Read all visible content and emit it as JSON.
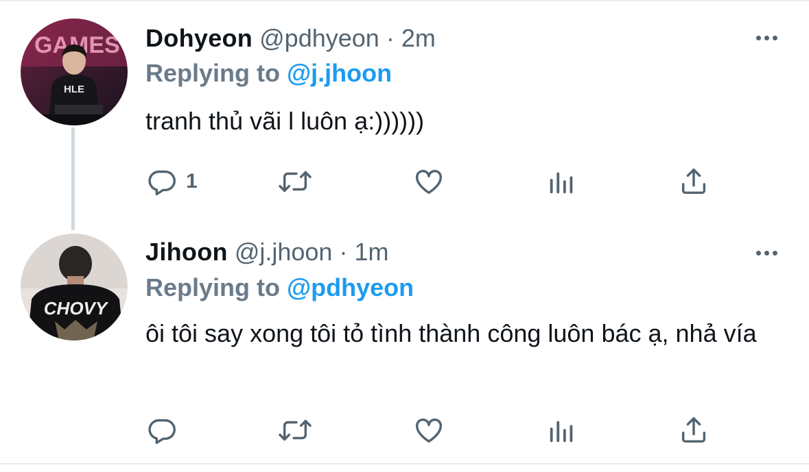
{
  "tweets": [
    {
      "display_name": "Dohyeon",
      "handle": "@pdhyeon",
      "separator": "·",
      "time": "2m",
      "replying_prefix": "Replying to",
      "replying_to": "@j.jhoon",
      "text": "tranh thủ vãi l luôn ạ:))))))",
      "avatar_text": "HLE",
      "avatar_bg_text": "GAMES",
      "reply_count": "1",
      "icons": [
        "reply-icon",
        "retweet-icon",
        "like-icon",
        "views-icon",
        "share-icon",
        "more-icon"
      ]
    },
    {
      "display_name": "Jihoon",
      "handle": "@j.jhoon",
      "separator": "·",
      "time": "1m",
      "replying_prefix": "Replying to",
      "replying_to": "@pdhyeon",
      "text": "ôi tôi say xong tôi tỏ tình thành công luôn bác ạ, nhả vía",
      "avatar_text": "CHOVY",
      "reply_count": "",
      "icons": [
        "reply-icon",
        "retweet-icon",
        "like-icon",
        "views-icon",
        "share-icon",
        "more-icon"
      ]
    }
  ],
  "colors": {
    "text_primary": "#0f1419",
    "text_secondary": "#536471",
    "replying_label": "#6a7b8a",
    "link": "#1d9bf0",
    "thread_line": "#cfd9de",
    "rule": "#e6ecf0"
  }
}
